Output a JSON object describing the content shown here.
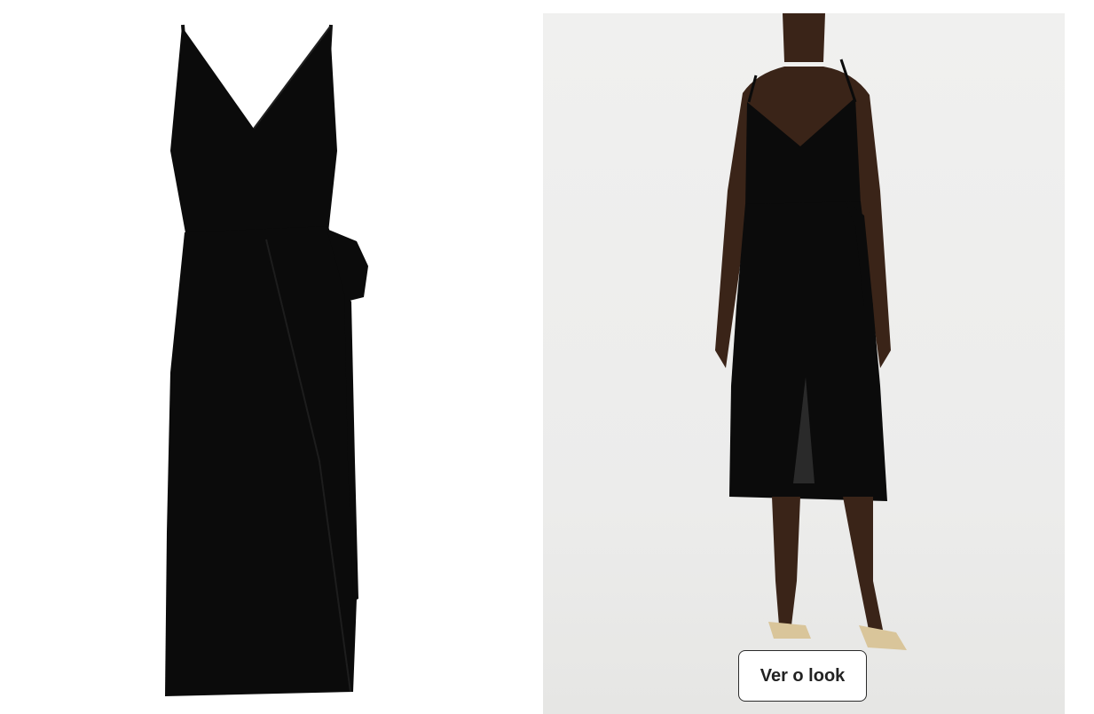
{
  "gallery": {
    "product_image_icon": "dress-flat-image",
    "model_image_icon": "model-wearing-dress-image",
    "look_button_label": "Ver o look"
  },
  "colors": {
    "dress": "#0b0b0b",
    "background": "#ffffff",
    "model_backdrop": "#eeeeed",
    "button_border": "#2b2b2b"
  }
}
